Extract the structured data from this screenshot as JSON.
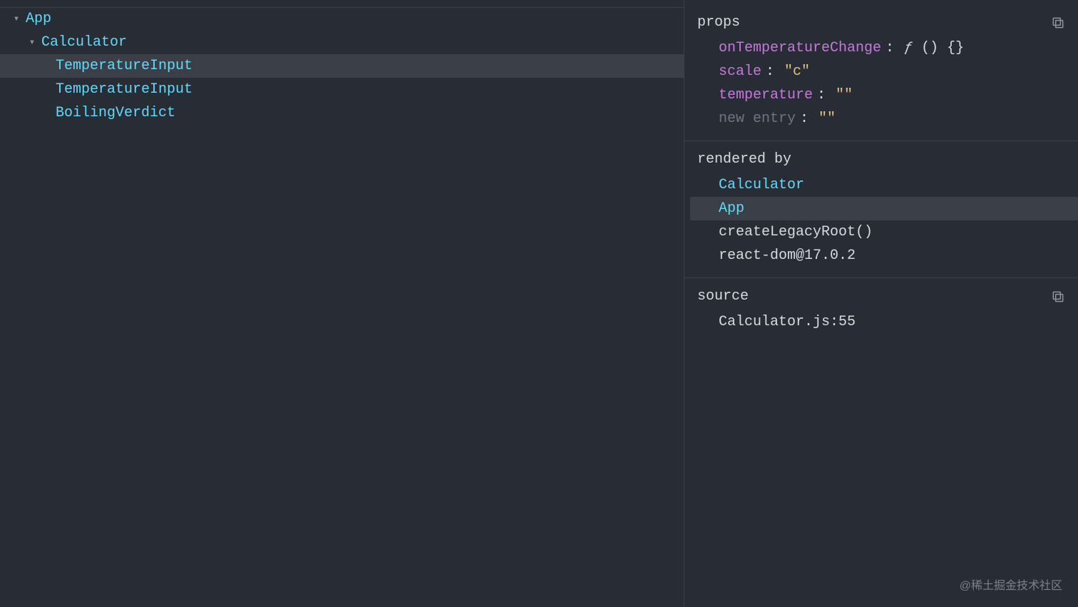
{
  "tree": {
    "root": {
      "name": "App"
    },
    "child": {
      "name": "Calculator"
    },
    "leaves": [
      {
        "name": "TemperatureInput",
        "selected": true
      },
      {
        "name": "TemperatureInput",
        "selected": false
      },
      {
        "name": "BoilingVerdict",
        "selected": false
      }
    ]
  },
  "inspector": {
    "props": {
      "title": "props",
      "onTemperatureChange": {
        "key": "onTemperatureChange",
        "value": "ƒ () {}"
      },
      "scale": {
        "key": "scale",
        "value": "\"c\""
      },
      "temperature": {
        "key": "temperature",
        "value": "\"\""
      },
      "newEntry": {
        "key": "new entry",
        "value": "\"\""
      }
    },
    "rendered_by": {
      "title": "rendered by",
      "items": [
        {
          "label": "Calculator",
          "type": "link",
          "highlighted": false
        },
        {
          "label": "App",
          "type": "link",
          "highlighted": true
        },
        {
          "label": "createLegacyRoot()",
          "type": "plain",
          "highlighted": false
        },
        {
          "label": "react-dom@17.0.2",
          "type": "plain",
          "highlighted": false
        }
      ]
    },
    "source": {
      "title": "source",
      "value": "Calculator.js:55"
    }
  },
  "watermark": "@稀土掘金技术社区"
}
